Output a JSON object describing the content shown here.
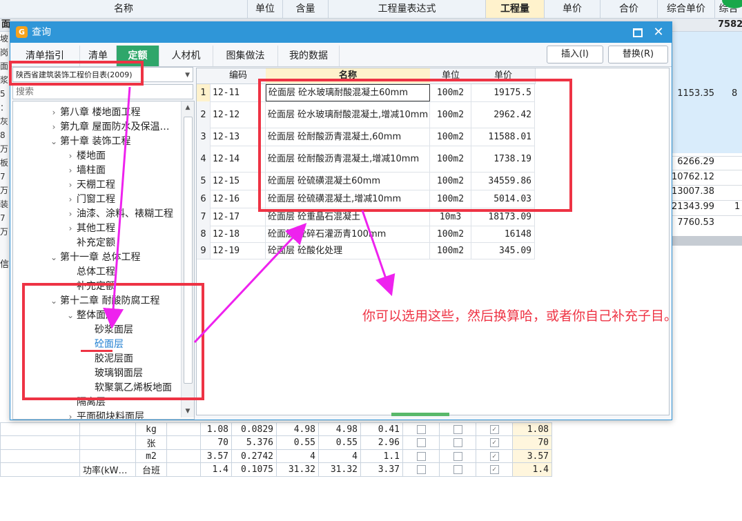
{
  "background": {
    "headers": [
      "名称",
      "单位",
      "含量",
      "工程量表达式",
      "工程量",
      "单价",
      "合价",
      "综合单价",
      "综合"
    ],
    "row1": {
      "left": "面",
      "right": "7582"
    },
    "left_strip": [
      "坡",
      "岗",
      "",
      "面",
      "浆",
      "5",
      "：",
      "灰",
      "",
      "8万",
      "板",
      "7万",
      "装",
      "7万"
    ],
    "values": [
      "1153.35",
      "8",
      "6266.29",
      "10762.12",
      "13007.38",
      "21343.99",
      "1",
      "7760.53"
    ],
    "left_label": "信"
  },
  "bottom_table": {
    "rows": [
      {
        "c1": "",
        "unit": "kg",
        "qty": "1.08",
        "content": "0.0829",
        "p1": "4.98",
        "p2": "4.98",
        "sum": "0.41",
        "cb3": true,
        "final": "1.08"
      },
      {
        "c1": "",
        "unit": "张",
        "qty": "70",
        "content": "5.376",
        "p1": "0.55",
        "p2": "0.55",
        "sum": "2.96",
        "cb3": true,
        "final": "70"
      },
      {
        "c1": "",
        "unit": "m2",
        "qty": "3.57",
        "content": "0.2742",
        "p1": "4",
        "p2": "4",
        "sum": "1.1",
        "cb3": true,
        "final": "3.57"
      },
      {
        "c1": "功率(kW…",
        "unit": "台班",
        "qty": "1.4",
        "content": "0.1075",
        "p1": "31.32",
        "p2": "31.32",
        "sum": "3.37",
        "cb3": true,
        "final": "1.4"
      }
    ]
  },
  "dialog": {
    "title": "查询",
    "tabs": [
      "清单指引",
      "清单",
      "定额",
      "人材机",
      "图集做法",
      "我的数据"
    ],
    "active_tab": "定额",
    "insert_label": "插入(I)",
    "replace_label": "替换(R)",
    "library": "陕西省建筑装饰工程价目表(2009)",
    "search_placeholder": "搜索",
    "tree": [
      {
        "label": "第八章 楼地面工程",
        "toggle": "›"
      },
      {
        "label": "第九章 屋面防水及保温…",
        "toggle": "›"
      },
      {
        "label": "第十章 装饰工程",
        "toggle": "⌄"
      },
      {
        "label": "楼地面",
        "toggle": "›"
      },
      {
        "label": "墙柱面",
        "toggle": "›"
      },
      {
        "label": "天棚工程",
        "toggle": "›"
      },
      {
        "label": "门窗工程",
        "toggle": "›"
      },
      {
        "label": "油漆、涂料、裱糊工程",
        "toggle": "›"
      },
      {
        "label": "其他工程",
        "toggle": "›"
      },
      {
        "label": "补充定额",
        "toggle": ""
      },
      {
        "label": "第十一章 总体工程",
        "toggle": "⌄"
      },
      {
        "label": "总体工程",
        "toggle": ""
      },
      {
        "label": "补充定额",
        "toggle": ""
      },
      {
        "label": "第十二章 耐酸防腐工程",
        "toggle": "⌄"
      },
      {
        "label": "整体面层",
        "toggle": "⌄"
      },
      {
        "label": "砂浆面层",
        "toggle": ""
      },
      {
        "label": "砼面层",
        "toggle": ""
      },
      {
        "label": "胶泥层面",
        "toggle": ""
      },
      {
        "label": "玻璃钢面层",
        "toggle": ""
      },
      {
        "label": "软聚氯乙烯板地面",
        "toggle": ""
      },
      {
        "label": "隔离层",
        "toggle": ""
      },
      {
        "label": "平面砌块料面层",
        "toggle": "›"
      }
    ],
    "grid": {
      "headers": [
        "",
        "编码",
        "名称",
        "单位",
        "单价"
      ],
      "rows": [
        {
          "no": "1",
          "code": "12-11",
          "name": "砼面层 砼水玻璃耐酸混凝土60mm",
          "unit": "100m2",
          "price": "19175.5"
        },
        {
          "no": "2",
          "code": "12-12",
          "name": "砼面层 砼水玻璃耐酸混凝土,增减10mm",
          "unit": "100m2",
          "price": "2962.42"
        },
        {
          "no": "3",
          "code": "12-13",
          "name": "砼面层 砼耐酸沥青混凝土,60mm",
          "unit": "100m2",
          "price": "11588.01"
        },
        {
          "no": "4",
          "code": "12-14",
          "name": "砼面层 砼耐酸沥青混凝土,增减10mm",
          "unit": "100m2",
          "price": "1738.19"
        },
        {
          "no": "5",
          "code": "12-15",
          "name": "砼面层 砼硫磺混凝土60mm",
          "unit": "100m2",
          "price": "34559.86"
        },
        {
          "no": "6",
          "code": "12-16",
          "name": "砼面层 砼硫磺混凝土,增减10mm",
          "unit": "100m2",
          "price": "5014.03"
        },
        {
          "no": "7",
          "code": "12-17",
          "name": "砼面层 砼重晶石混凝土",
          "unit": "10m3",
          "price": "18173.09"
        },
        {
          "no": "8",
          "code": "12-18",
          "name": "砼面层 砼碎石灌沥青100mm",
          "unit": "100m2",
          "price": "16148"
        },
        {
          "no": "9",
          "code": "12-19",
          "name": "砼面层 砼酸化处理",
          "unit": "100m2",
          "price": "345.09"
        }
      ]
    }
  },
  "annotation": {
    "text": "你可以选用这些，然后换算哈，或者你自己补充子目。",
    "color": "#ee3344",
    "arrow_color": "#ee22ee"
  }
}
